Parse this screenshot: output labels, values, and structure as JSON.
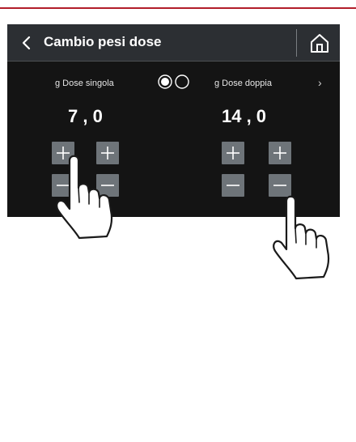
{
  "header": {
    "title": "Cambio pesi dose",
    "back_icon": "chevron-left-icon",
    "home_icon": "home-icon"
  },
  "single": {
    "label": "g Dose singola",
    "value": "7 , 0"
  },
  "double": {
    "label": "g Dose doppia",
    "value": "14 , 0"
  },
  "page_indicator": {
    "count": 2,
    "active": 1
  },
  "next_arrow": "›",
  "colors": {
    "accent_rule": "#b21e2a",
    "screen_bg": "#141414",
    "header_bg": "#2c2f33",
    "button_bg": "#6e7479"
  }
}
